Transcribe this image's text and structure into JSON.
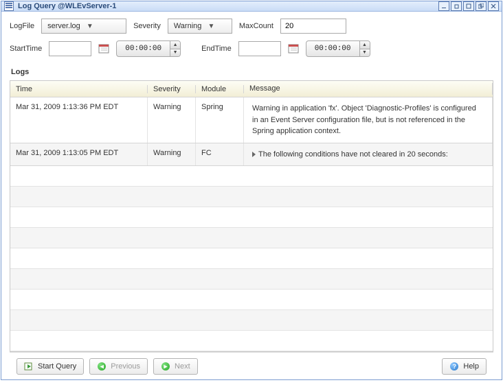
{
  "window": {
    "title": "Log Query @WLEvServer-1"
  },
  "form": {
    "logfile_label": "LogFile",
    "logfile_value": "server.log",
    "severity_label": "Severity",
    "severity_value": "Warning",
    "maxcount_label": "MaxCount",
    "maxcount_value": "20",
    "starttime_label": "StartTime",
    "starttime_value": "",
    "start_spinner": "00:00:00",
    "endtime_label": "EndTime",
    "endtime_value": "",
    "end_spinner": "00:00:00"
  },
  "section_title": "Logs",
  "columns": {
    "time": "Time",
    "severity": "Severity",
    "module": "Module",
    "message": "Message"
  },
  "rows": [
    {
      "time": "Mar 31, 2009 1:13:36 PM EDT",
      "severity": "Warning",
      "module": "Spring",
      "message": "Warning in application 'fx'.  Object 'Diagnostic-Profiles' is configured in an Event Server configuration file, but is not referenced in the Spring application context.",
      "expandable": false
    },
    {
      "time": "Mar 31, 2009 1:13:05 PM EDT",
      "severity": "Warning",
      "module": "FC",
      "message": "The following conditions have not cleared in 20 seconds:",
      "expandable": true
    }
  ],
  "buttons": {
    "start_query": "Start Query",
    "previous": "Previous",
    "next": "Next",
    "help": "Help"
  }
}
